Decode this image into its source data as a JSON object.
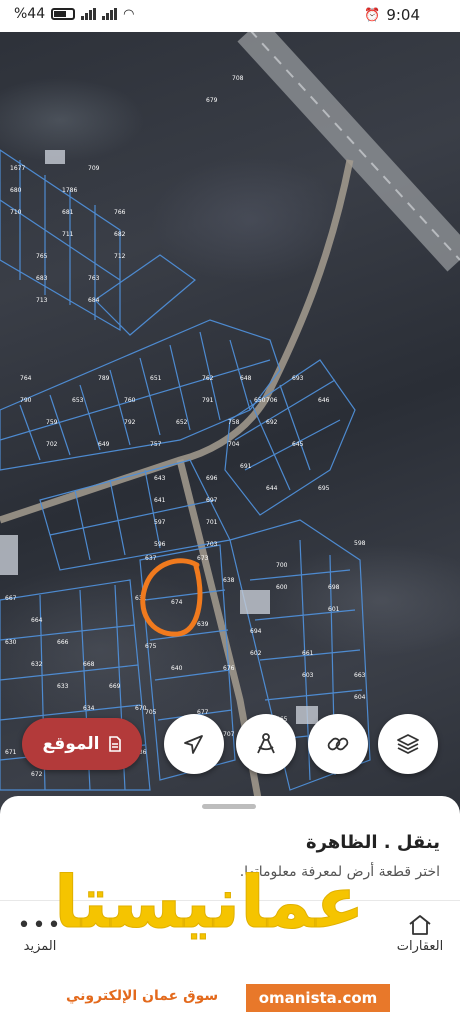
{
  "status_bar": {
    "battery": "%44",
    "time": "9:04"
  },
  "map": {
    "parcel_labels": [
      "1677",
      "1786",
      "766",
      "765",
      "763",
      "764",
      "762",
      "760",
      "759",
      "758",
      "757",
      "693",
      "692",
      "691",
      "695",
      "696",
      "697",
      "701",
      "703",
      "700",
      "698",
      "694",
      "661",
      "663",
      "665",
      "662",
      "667",
      "664",
      "666",
      "668",
      "669",
      "670",
      "671",
      "672",
      "673",
      "674",
      "675",
      "676",
      "677",
      "678",
      "679",
      "680",
      "681",
      "682",
      "683",
      "684",
      "651",
      "653",
      "650",
      "652",
      "649",
      "648",
      "646",
      "645",
      "644",
      "643",
      "641",
      "597",
      "596",
      "598",
      "600",
      "601",
      "602",
      "603",
      "604",
      "605",
      "606",
      "631",
      "630",
      "632",
      "633",
      "634",
      "635",
      "636",
      "637",
      "638",
      "639",
      "640",
      "705",
      "707",
      "708",
      "709",
      "710",
      "711",
      "712",
      "713",
      "789",
      "790",
      "791",
      "792",
      "702",
      "704",
      "706"
    ]
  },
  "location_button": {
    "label": "الموقع"
  },
  "map_buttons": {
    "layers": "layers-icon",
    "link": "link-icon",
    "measure": "measure-icon",
    "navigate": "navigate-icon"
  },
  "sheet": {
    "title": "ينقل . الظاهرة",
    "subtitle": "اختر قطعة أرض لمعرفة معلوماتها."
  },
  "bottom_nav": {
    "items": [
      {
        "label": "العقارات",
        "icon": "home-icon"
      },
      {
        "label": "المزيد",
        "icon": "more-icon"
      }
    ]
  },
  "watermark": {
    "brand": "عمانيستا",
    "url": "omanista.com",
    "tagline": "سوق عمان الإلكتروني"
  },
  "colors": {
    "accent": "#b33a3a",
    "parcel_line": "#4f8fd8",
    "annotation": "#f07a1e",
    "watermark_yellow": "#f5c400"
  }
}
